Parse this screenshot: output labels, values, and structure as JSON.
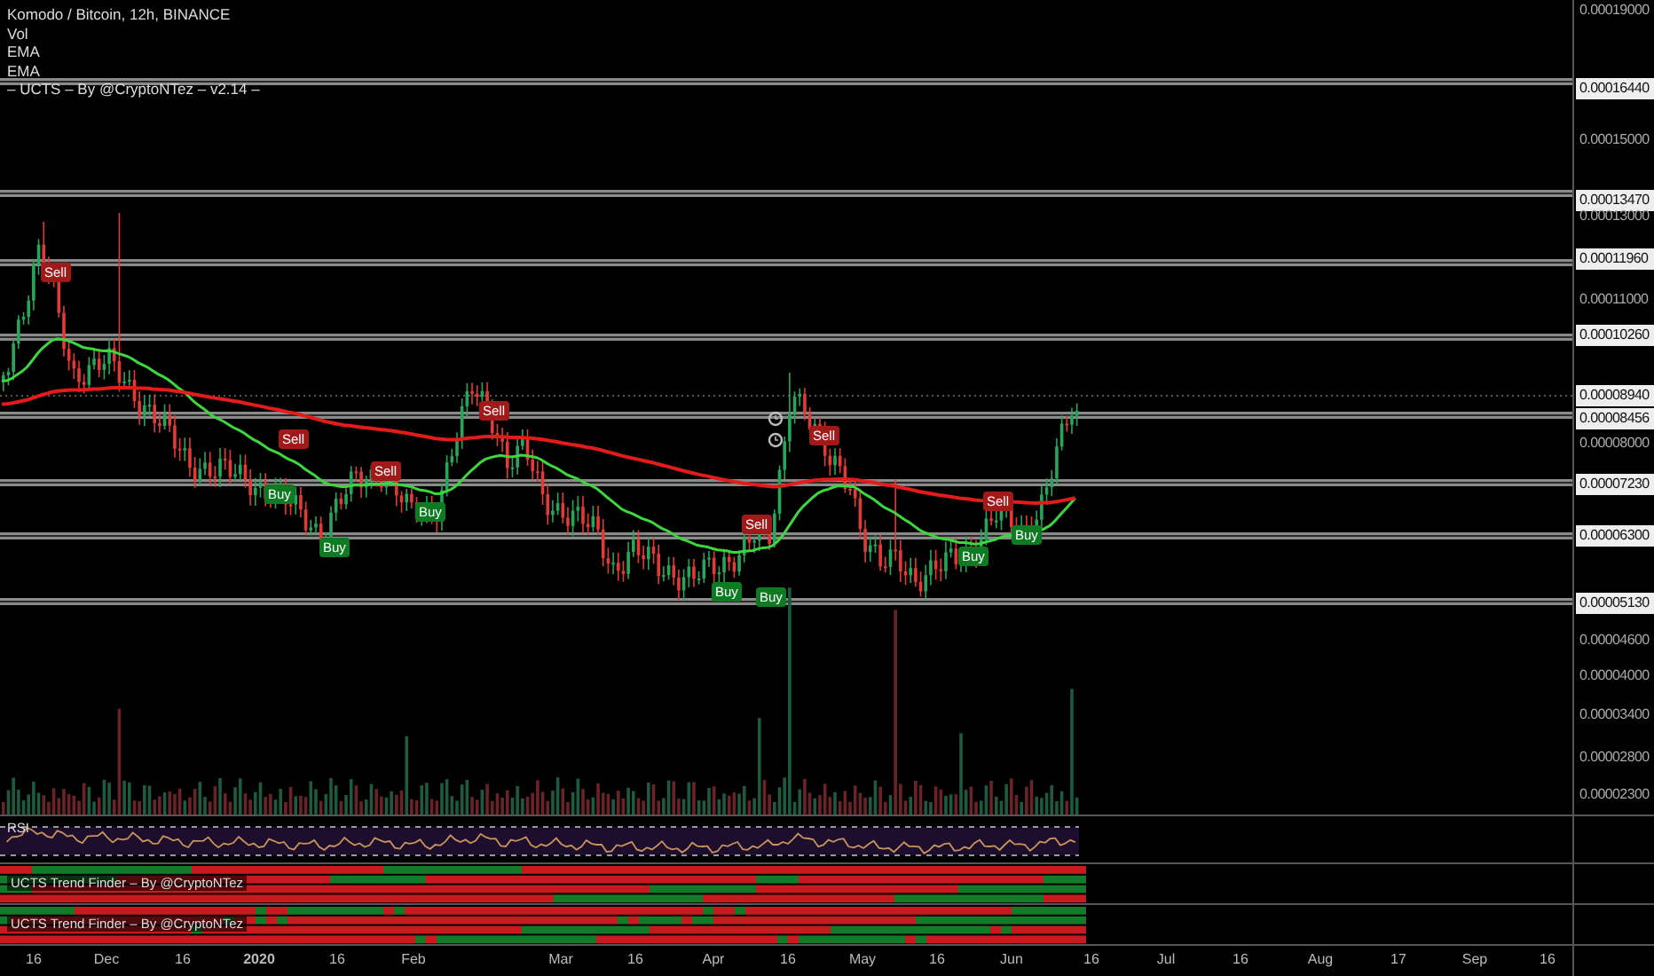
{
  "chart": {
    "legend": [
      "Komodo / Bitcoin, 12h, BINANCE",
      "Vol",
      "EMA",
      "EMA",
      "– UCTS – By @CryptoNTez – v2.14 –"
    ],
    "signals": [
      {
        "kind": "sell",
        "label": "Sell"
      },
      {
        "kind": "buy",
        "label": "Buy"
      },
      {
        "kind": "sell",
        "label": "Sell"
      },
      {
        "kind": "buy",
        "label": "Buy"
      },
      {
        "kind": "sell",
        "label": "Sell"
      },
      {
        "kind": "buy",
        "label": "Buy"
      },
      {
        "kind": "sell",
        "label": "Sell"
      },
      {
        "kind": "buy",
        "label": "Buy"
      },
      {
        "kind": "sell",
        "label": "Sell"
      },
      {
        "kind": "buy",
        "label": "Buy"
      },
      {
        "kind": "sell",
        "label": "Sell"
      },
      {
        "kind": "buy",
        "label": "Buy"
      },
      {
        "kind": "sell",
        "label": "Sell"
      },
      {
        "kind": "buy",
        "label": "Buy"
      }
    ]
  },
  "price_axis": {
    "labels": [
      {
        "text": "0.00019000",
        "kind": "tick"
      },
      {
        "text": "0.00016440",
        "kind": "level"
      },
      {
        "text": "0.00015000",
        "kind": "tick"
      },
      {
        "text": "0.00013470",
        "kind": "level"
      },
      {
        "text": "0.00013000",
        "kind": "tick"
      },
      {
        "text": "0.00011960",
        "kind": "level"
      },
      {
        "text": "0.00011000",
        "kind": "tick"
      },
      {
        "text": "0.00010260",
        "kind": "level"
      },
      {
        "text": "0.00008940",
        "kind": "level"
      },
      {
        "text": "0.00008456",
        "kind": "level"
      },
      {
        "text": "0.00008000",
        "kind": "tick"
      },
      {
        "text": "0.00007230",
        "kind": "level"
      },
      {
        "text": "0.00006300",
        "kind": "level"
      },
      {
        "text": "0.00005130",
        "kind": "level"
      },
      {
        "text": "0.00004600",
        "kind": "tick"
      },
      {
        "text": "0.00004000",
        "kind": "tick"
      },
      {
        "text": "0.00003400",
        "kind": "tick"
      },
      {
        "text": "0.00002800",
        "kind": "tick"
      },
      {
        "text": "0.00002300",
        "kind": "tick"
      }
    ]
  },
  "rsi_pane": {
    "label": "RSI"
  },
  "trend_panes": [
    {
      "label": "UCTS Trend Finder – By @CryptoNTez"
    },
    {
      "label": "UCTS Trend Finder – By @CryptoNTez"
    }
  ],
  "time_axis": {
    "labels": [
      "16",
      "Dec",
      "16",
      "2020",
      "16",
      "Feb",
      "Mar",
      "16",
      "Apr",
      "16",
      "May",
      "16",
      "Jun",
      "16",
      "Jul",
      "16",
      "Aug",
      "17",
      "Sep",
      "16"
    ]
  }
}
